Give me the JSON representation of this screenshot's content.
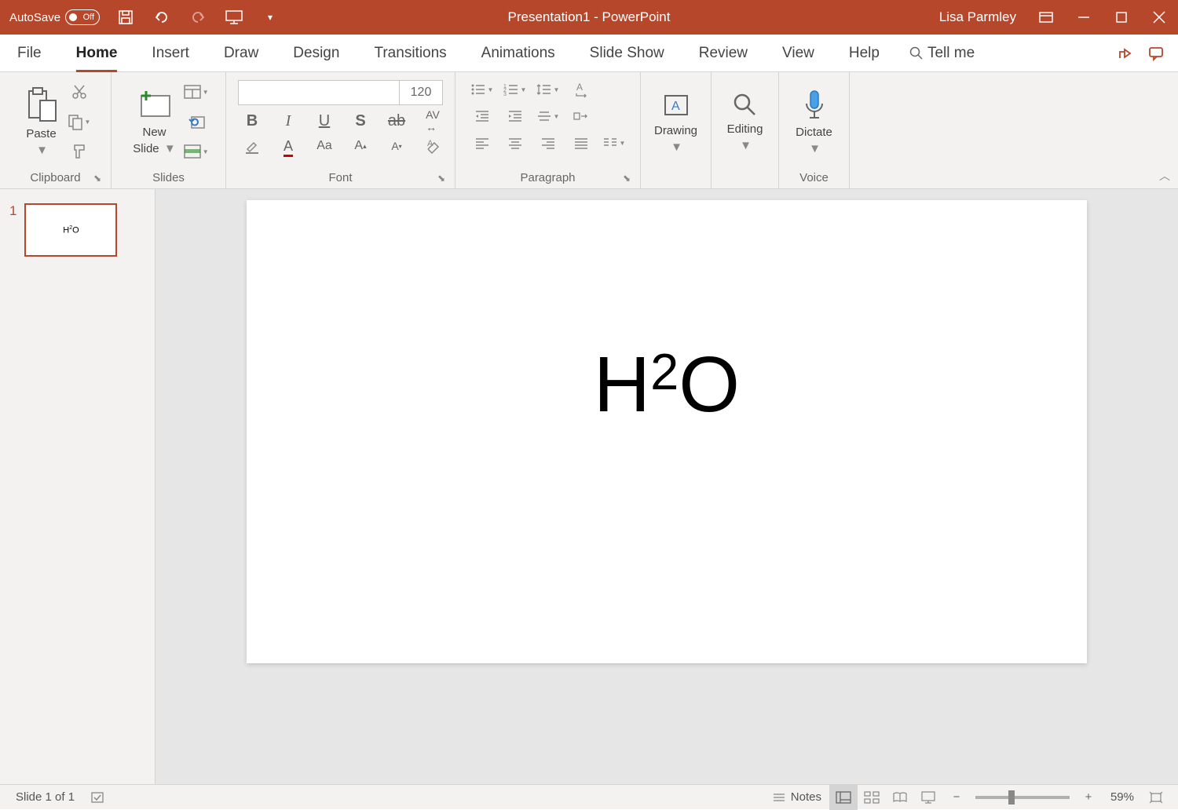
{
  "title": {
    "doc": "Presentation1",
    "sep": "  -  ",
    "app": "PowerPoint"
  },
  "user": "Lisa Parmley",
  "autosave": {
    "label": "AutoSave",
    "state": "Off"
  },
  "tabs": [
    "File",
    "Home",
    "Insert",
    "Draw",
    "Design",
    "Transitions",
    "Animations",
    "Slide Show",
    "Review",
    "View",
    "Help"
  ],
  "active_tab": "Home",
  "tellme": "Tell me",
  "ribbon": {
    "clipboard": {
      "paste": "Paste",
      "label": "Clipboard"
    },
    "slides": {
      "new": "New",
      "slide": "Slide",
      "label": "Slides"
    },
    "font": {
      "size": "120",
      "label": "Font"
    },
    "paragraph": {
      "label": "Paragraph"
    },
    "drawing": {
      "btn": "Drawing"
    },
    "editing": {
      "btn": "Editing"
    },
    "voice": {
      "btn": "Dictate",
      "label": "Voice"
    }
  },
  "thumb": {
    "num": "1",
    "text_h": "H",
    "text_sup": "2",
    "text_o": "O"
  },
  "slide": {
    "text_h": "H",
    "text_sup": "2",
    "text_o": "O"
  },
  "status": {
    "slide": "Slide 1 of 1",
    "notes": "Notes",
    "zoom": "59%"
  }
}
